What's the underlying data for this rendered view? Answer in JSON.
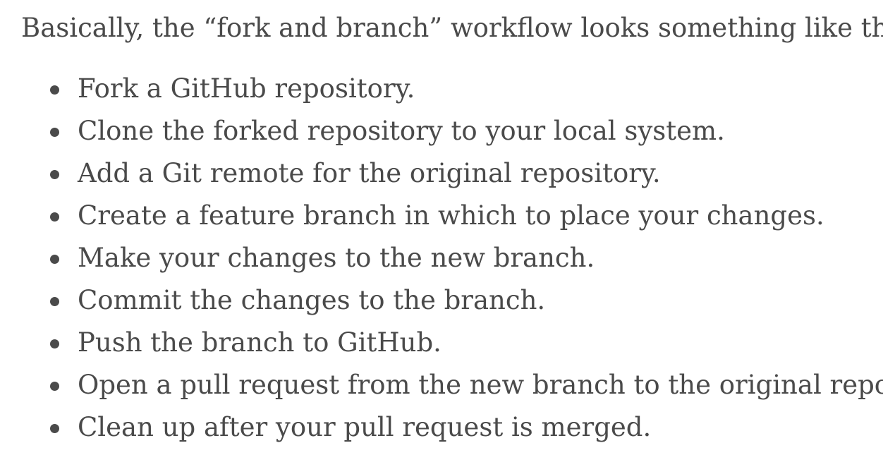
{
  "article": {
    "intro": "Basically, the “fork and branch” workflow looks something like this:",
    "steps": [
      "Fork a GitHub repository.",
      "Clone the forked repository to your local system.",
      "Add a Git remote for the original repository.",
      "Create a feature branch in which to place your changes.",
      "Make your changes to the new branch.",
      "Commit the changes to the branch.",
      "Push the branch to GitHub.",
      "Open a pull request from the new branch to the original repo.",
      "Clean up after your pull request is merged."
    ]
  },
  "colors": {
    "text": "#4a4a4a",
    "background": "#ffffff"
  },
  "icons": {
    "list_bullet": "filled-circle"
  }
}
